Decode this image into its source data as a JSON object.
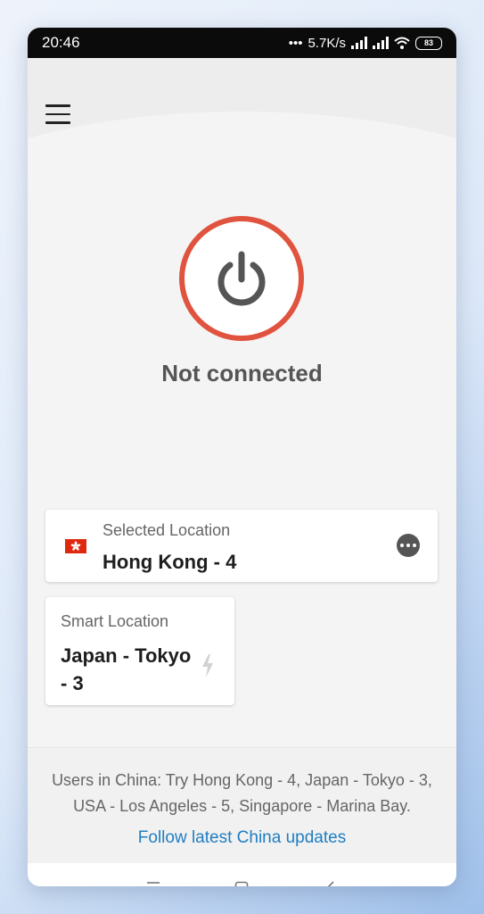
{
  "statusbar": {
    "time": "20:46",
    "network_speed": "5.7K/s",
    "battery": "83"
  },
  "main": {
    "connection_status": "Not connected"
  },
  "selected_location": {
    "label": "Selected Location",
    "value": "Hong Kong - 4"
  },
  "smart_location": {
    "label": "Smart Location",
    "value": "Japan - Tokyo - 3"
  },
  "footer": {
    "notice": "Users in China: Try Hong Kong - 4, Japan - Tokyo - 3, USA - Los Angeles - 5, Singapore - Marina Bay.",
    "link": "Follow latest China updates"
  },
  "colors": {
    "power_ring": "#e0533f",
    "link": "#1f7ec2",
    "flag": "#de2910"
  },
  "icons": [
    "menu-icon",
    "power-icon",
    "flag-icon",
    "more-icon",
    "lightning-icon",
    "recents-icon",
    "home-icon",
    "back-icon"
  ]
}
